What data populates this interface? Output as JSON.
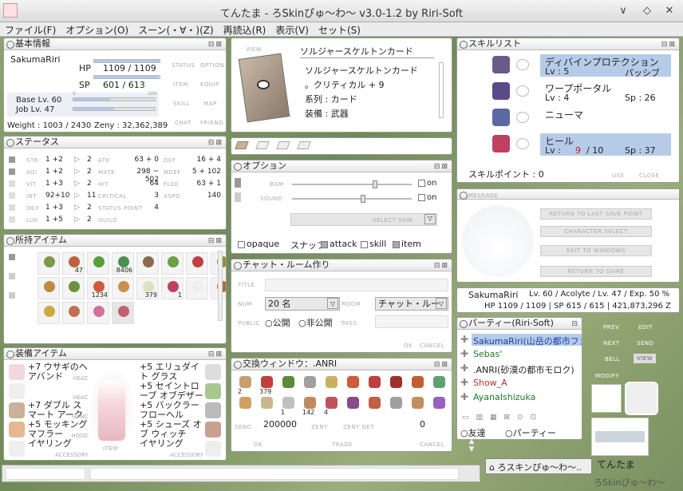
{
  "app": {
    "title": "てんたま - ろSkinぴゅ〜わ〜 v3.0-1.2 by Riri-Soft",
    "minimize": "∨",
    "restore": "◇",
    "close": "✕"
  },
  "menu": [
    "ファイル(F)",
    "オプション(O)",
    "スーン(・∀・)(Z)",
    "再読込(R)",
    "表示(V)",
    "セット(S)"
  ],
  "basic": {
    "title": "基本情報",
    "name": "SakumaRiri",
    "hp_label": "HP",
    "hp": "1109 / 1109",
    "sp_label": "SP",
    "sp": "601 / 613",
    "hp_fill": 1.0,
    "sp_fill": 0.98,
    "base": "Base Lv. 60",
    "job": "Job Lv. 47",
    "base_max": "100",
    "base_zero": "0",
    "weight": "Weight : 1003 / 2430",
    "zeny": "Zeny : 32,362,389",
    "buttons": [
      "STATUS",
      "OPTION",
      "ITEM",
      "EQUIP",
      "SKILL",
      "MAP",
      "CHAT",
      "FRIEND"
    ]
  },
  "status": {
    "title": "ステータス",
    "stats": [
      {
        "k": "STR",
        "v": "1 +2",
        "p": "2"
      },
      {
        "k": "AGI",
        "v": "1 +2",
        "p": "2"
      },
      {
        "k": "VIT",
        "v": "1 +3",
        "p": "2"
      },
      {
        "k": "INT",
        "v": "92+10",
        "p": "11"
      },
      {
        "k": "DEX",
        "v": "1 +3",
        "p": "2"
      },
      {
        "k": "LUK",
        "v": "1 +5",
        "p": "2"
      }
    ],
    "derived": [
      {
        "k": "ATK",
        "v": "63 + 0",
        "k2": "DEF",
        "v2": "16 + 4"
      },
      {
        "k": "MATK",
        "v": "298 ~ 502",
        "k2": "MDEF",
        "v2": "5 + 102"
      },
      {
        "k": "HIT",
        "v": "64",
        "k2": "FLEE",
        "v2": "63 + 1"
      },
      {
        "k": "CRITICAL",
        "v": "3",
        "k2": "ASPD",
        "v2": "140"
      },
      {
        "k": "STATUS POINT",
        "v": "4",
        "k2": "",
        "v2": ""
      },
      {
        "k": "GUILD",
        "v": "",
        "k2": "",
        "v2": ""
      }
    ]
  },
  "items": {
    "title": "所持アイテム",
    "counts": [
      "",
      "47",
      "",
      "8406",
      "",
      "",
      "",
      "",
      "",
      "",
      "1234",
      "",
      "379",
      "1",
      "",
      "",
      "",
      "",
      "",
      ""
    ]
  },
  "equip": {
    "title": "装備アイテム",
    "left": [
      {
        "n": "+7 ウサギのヘアバンド",
        "k": "HEAD"
      },
      {
        "n": "",
        "k": "HEAD"
      },
      {
        "n": "+7 ダブル スマート アーク",
        "k": "HAND"
      },
      {
        "n": "+5 モッキング マフラー",
        "k": "HOOD"
      },
      {
        "n": "イヤリング",
        "k": "ACCESSORY"
      }
    ],
    "right": [
      {
        "n": "+5 エリュダイト グラス",
        "k": ""
      },
      {
        "n": "+5 セイントローブ オブデザー",
        "k": ""
      },
      {
        "n": "+5 バックラー フローへル",
        "k": ""
      },
      {
        "n": "+5 シューズ オブ ウィッチ",
        "k": ""
      },
      {
        "n": "イヤリング",
        "k": "ACCESSORY"
      }
    ],
    "char_label": "ITEM"
  },
  "card": {
    "view": "VIEW",
    "name": "ソルジャースケルトンカード",
    "desc": [
      "ソルジャースケルトンカード",
      "。クリティカル + 9",
      "系列 : カード",
      "装備 : 武器"
    ]
  },
  "option": {
    "title": "オプション",
    "bgm": "BGM",
    "sound": "SOUND",
    "on1": "on",
    "on2": "on",
    "bgm_level": 0.7,
    "sound_level": 0.6,
    "select_skin": "SELECT SKIN",
    "opaque": "opaque",
    "snap": "スナップ",
    "attack": "attack",
    "skill": "skill",
    "item": "item"
  },
  "chat": {
    "title": "チャット・ルーム作り",
    "lbl_title": "TITLE",
    "lbl_num": "NUM",
    "num": "20 名",
    "lbl_room": "ROOM",
    "room": "チャット・ルー",
    "lbl_public": "PUBLIC",
    "pub": "公開",
    "priv": "非公開",
    "lbl_pass": "PASS",
    "ok": "OK",
    "cancel": "CANCEL"
  },
  "trade": {
    "title": "交換ウィンドウ：.ANRI",
    "counts": [
      "2",
      "379",
      "",
      "",
      "",
      "",
      "",
      "",
      "",
      "",
      "",
      "",
      "1",
      "142",
      "4",
      "",
      "",
      "",
      "",
      ""
    ],
    "send": "SEND",
    "amount": "200000",
    "zeny_get": "ZENY GET",
    "got": "0",
    "zeny": "ZENY",
    "ok": "OK",
    "trade": "TRADE",
    "cancel": "CANCEL"
  },
  "skills": {
    "title": "スキルリスト",
    "list": [
      {
        "n": "ディバインプロテクション",
        "lv": "Lv : 5",
        "sp": "パッシブ",
        "hl": true
      },
      {
        "n": "ワープポータル",
        "lv": "Lv : 4",
        "sp": "Sp : 26",
        "hl": false
      },
      {
        "n": "ニューマ",
        "lv": "",
        "sp": "",
        "hl": false
      },
      {
        "n": "ヒール",
        "lv": "Lv : ",
        "cur": "9",
        "max": "/ 10",
        "sp": "Sp : 37",
        "hl": true
      }
    ],
    "points": "スキルポイント : 0",
    "use": "USE",
    "close": "CLOSE"
  },
  "message": {
    "title": "MESSAGE",
    "buttons": [
      "RETURN TO LAST SAVE POINT",
      "CHARACTER SELECT",
      "EXIT TO WINDOWS",
      "RETURN TO GAME"
    ]
  },
  "charinfo": {
    "name": "SakumaRiri",
    "lv": "Lv. 60 / Acolyte / Lv. 47 / Exp. 50 %",
    "hp": "HP 1109 / 1109 | SP 615 / 615 | 421,873,296 Z"
  },
  "party": {
    "title": "パーティー(Riri-Soft)",
    "members": [
      {
        "n": "SakumaRiri(山岳の都市フェ",
        "c": "#1a3fa8",
        "hl": true
      },
      {
        "n": "Sebas'",
        "c": "#1a7a2a",
        "hl": false
      },
      {
        "n": ".ANRI(砂漠の都市モロク)",
        "c": "#222",
        "hl": false
      },
      {
        "n": "Show_A",
        "c": "#b03030",
        "hl": false
      },
      {
        "n": "AyanaIshizuka",
        "c": "#1a7a2a",
        "hl": false
      }
    ],
    "tab_friend": "友達",
    "tab_party": "パーティー"
  },
  "side": {
    "buttons": [
      "PREV",
      "EDIT",
      "NEXT",
      "SEND",
      "BELL",
      "VIEW",
      "MODIFY"
    ],
    "char_name": "てんたま"
  },
  "taskbar": {
    "item": "ろスキンぴゅ〜わ〜..",
    "skin_text": "ろSkinぴゅ〜わ〜"
  }
}
